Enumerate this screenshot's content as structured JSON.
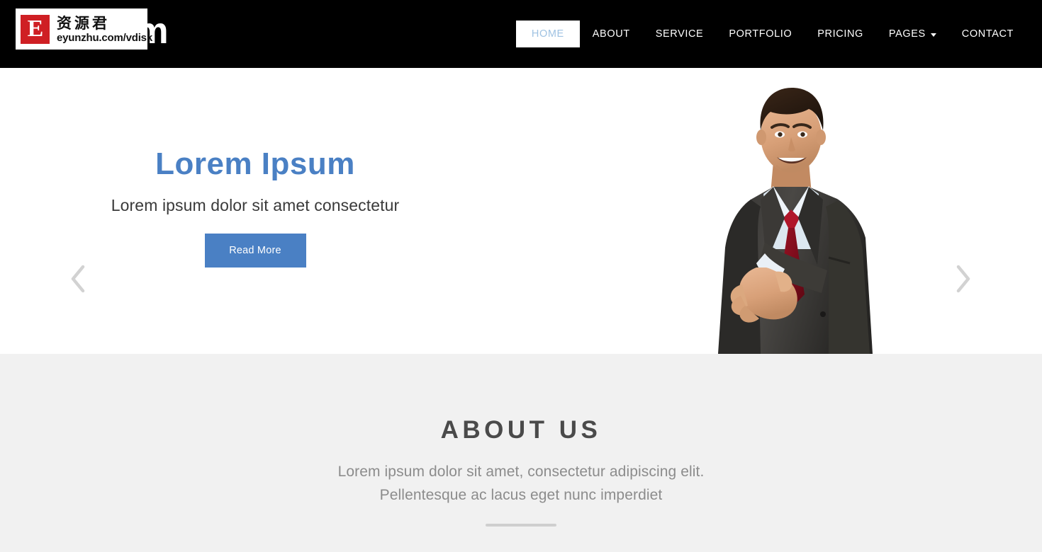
{
  "header": {
    "brand": "Freedom",
    "background_color": "#000000",
    "nav": [
      {
        "label": "HOME",
        "active": true,
        "has_caret": false
      },
      {
        "label": "ABOUT",
        "active": false,
        "has_caret": false
      },
      {
        "label": "SERVICE",
        "active": false,
        "has_caret": false
      },
      {
        "label": "PORTFOLIO",
        "active": false,
        "has_caret": false
      },
      {
        "label": "PRICING",
        "active": false,
        "has_caret": false
      },
      {
        "label": "PAGES",
        "active": false,
        "has_caret": true
      },
      {
        "label": "CONTACT",
        "active": false,
        "has_caret": false
      }
    ]
  },
  "watermark": {
    "logo_letter": "E",
    "chinese": "资源君",
    "url": "eyunzhu.com/vdisk",
    "logo_color": "#cf1f24"
  },
  "hero": {
    "title": "Lorem Ipsum",
    "title_color": "#4a80c4",
    "subtitle": "Lorem ipsum dolor sit amet consectetur",
    "button_label": "Read More",
    "button_color": "#4a80c4",
    "prev_icon": "chevron-left-icon",
    "next_icon": "chevron-right-icon",
    "slides": [
      {
        "index": 1,
        "active": true
      },
      {
        "index": 2,
        "active": false
      },
      {
        "index": 3,
        "active": false
      }
    ],
    "photo_alt": "businessman-handshake-photo"
  },
  "about": {
    "title": "ABOUT US",
    "line1": "Lorem ipsum dolor sit amet, consectetur adipiscing elit.",
    "line2": "Pellentesque ac lacus eget nunc imperdiet",
    "background_color": "#f1f1f1"
  }
}
